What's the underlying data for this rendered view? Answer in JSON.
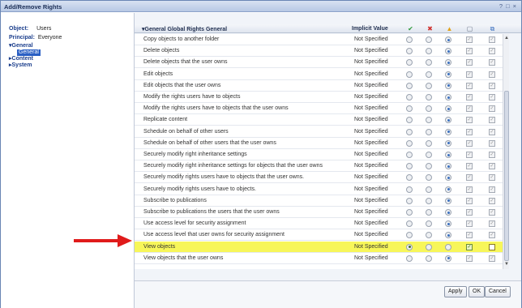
{
  "window": {
    "title": "Add/Remove Rights",
    "controls": [
      "?",
      "□",
      "×"
    ]
  },
  "left": {
    "object_label": "Object:",
    "object_value": "Users",
    "principal_label": "Principal:",
    "principal_value": "Everyone",
    "tree": [
      {
        "label": "▾General",
        "selected_child": "General"
      },
      {
        "label": "▸Content"
      },
      {
        "label": "▸System"
      }
    ]
  },
  "header": {
    "name": "▾General Global Rights General",
    "implicit": "Implicit Value",
    "icons": [
      {
        "name": "granted-icon",
        "glyph": "✔",
        "color": "#2f9a3a"
      },
      {
        "name": "denied-icon",
        "glyph": "✖",
        "color": "#d0312d"
      },
      {
        "name": "not-specified-icon",
        "glyph": "▲",
        "color": "#e1a21a"
      },
      {
        "name": "apply-to-object-icon",
        "glyph": "▢",
        "color": "#6a7486"
      },
      {
        "name": "apply-to-sub-objects-icon",
        "glyph": "⧉",
        "color": "#3a6fbe"
      }
    ]
  },
  "rows": [
    {
      "label": "Copy objects to another folder",
      "implicit": "Not Specified",
      "selected": 2,
      "highlight": false
    },
    {
      "label": "Delete objects",
      "implicit": "Not Specified",
      "selected": 2,
      "highlight": false
    },
    {
      "label": "Delete objects that the user owns",
      "implicit": "Not Specified",
      "selected": 2,
      "highlight": false
    },
    {
      "label": "Edit objects",
      "implicit": "Not Specified",
      "selected": 2,
      "highlight": false
    },
    {
      "label": "Edit objects that the user owns",
      "implicit": "Not Specified",
      "selected": 2,
      "highlight": false
    },
    {
      "label": "Modify the rights users have to objects",
      "implicit": "Not Specified",
      "selected": 2,
      "highlight": false
    },
    {
      "label": "Modify the rights users have to objects that the user owns",
      "implicit": "Not Specified",
      "selected": 2,
      "highlight": false
    },
    {
      "label": "Replicate content",
      "implicit": "Not Specified",
      "selected": 2,
      "highlight": false
    },
    {
      "label": "Schedule on behalf of other users",
      "implicit": "Not Specified",
      "selected": 2,
      "highlight": false
    },
    {
      "label": "Schedule on behalf of other users that the user owns",
      "implicit": "Not Specified",
      "selected": 2,
      "highlight": false
    },
    {
      "label": "Securely modify right inheritance settings",
      "implicit": "Not Specified",
      "selected": 2,
      "highlight": false
    },
    {
      "label": "Securely modify right inheritance settings for objects that the user owns",
      "implicit": "Not Specified",
      "selected": 2,
      "highlight": false
    },
    {
      "label": "Securely modify rights users have to objects that the user owns.",
      "implicit": "Not Specified",
      "selected": 2,
      "highlight": false
    },
    {
      "label": "Securely modify rights users have to objects.",
      "implicit": "Not Specified",
      "selected": 2,
      "highlight": false
    },
    {
      "label": "Subscribe to publications",
      "implicit": "Not Specified",
      "selected": 2,
      "highlight": false
    },
    {
      "label": "Subscribe to publications the users that the user owns",
      "implicit": "Not Specified",
      "selected": 2,
      "highlight": false
    },
    {
      "label": "Use access level for security assignment",
      "implicit": "Not Specified",
      "selected": 2,
      "highlight": false
    },
    {
      "label": "Use access level that user owns for security assignment",
      "implicit": "Not Specified",
      "selected": 2,
      "highlight": false
    },
    {
      "label": "View objects",
      "implicit": "Not Specified",
      "selected": 0,
      "highlight": true,
      "apply_object": true,
      "apply_sub": false
    },
    {
      "label": "View objects that the user owns",
      "implicit": "Not Specified",
      "selected": 2,
      "highlight": false
    }
  ],
  "footer": {
    "apply": "Apply",
    "ok": "OK",
    "cancel": "Cancel"
  },
  "colors": {
    "highlight": "#f7f65a",
    "arrow": "#e01b1b",
    "accent": "#2a5fc4"
  }
}
